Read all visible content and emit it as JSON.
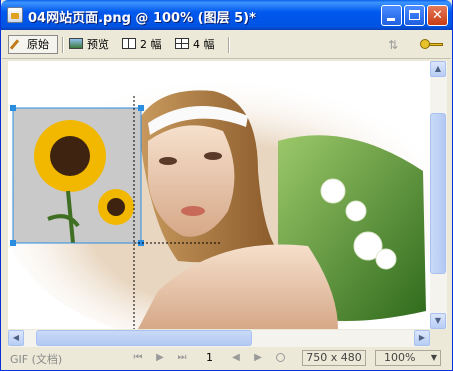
{
  "window": {
    "title": "04网站页面.png @ 100% (图层 5)*"
  },
  "toolbar": {
    "original_label": "原始",
    "preview_label": "预览",
    "two_up_label": "2 幅",
    "four_up_label": "4 幅"
  },
  "icons": {
    "app": "fireworks-document-icon",
    "original": "pencil-icon",
    "preview": "image-preview-icon",
    "two_up": "two-panel-icon",
    "four_up": "four-panel-icon",
    "sort": "sort-arrows-icon",
    "key": "key-icon"
  },
  "status": {
    "format": "GIF (文档)",
    "page": "1",
    "size": "750 x 480",
    "zoom": "100%"
  },
  "colors": {
    "titlebar": "#0054e3",
    "selection": "#2a8de0",
    "scrollbar": "#c1d3fb"
  }
}
